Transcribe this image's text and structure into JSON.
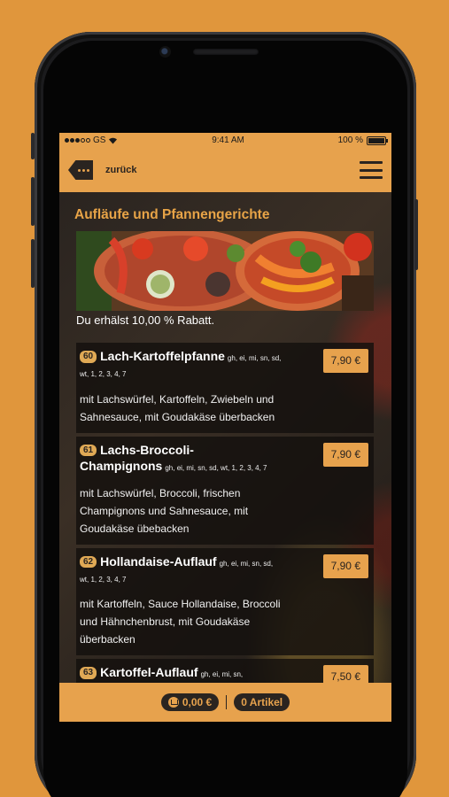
{
  "status": {
    "carrier": "GS",
    "time": "9:41 AM",
    "battery": "100 %"
  },
  "nav": {
    "back_label": "zurück"
  },
  "category": {
    "title": "Aufläufe und Pfannengerichte",
    "discount_text": "Du erhälst 10,00 % Rabatt."
  },
  "items": [
    {
      "number": "60",
      "name": "Lach-Kartoffelpfanne",
      "allergens": "gh, ei, mi, sn, sd, wt, 1, 2, 3, 4, 7",
      "price": "7,90 €",
      "description": "mit Lachswürfel, Kartoffeln, Zwiebeln und Sahnesauce, mit Goudakäse überbacken"
    },
    {
      "number": "61",
      "name": "Lachs-Broccoli-Champignons",
      "allergens": "gh, ei, mi, sn, sd, wt, 1, 2, 3, 4, 7",
      "price": "7,90 €",
      "description": "mit Lachswürfel, Broccoli, frischen Champignons und Sahnesauce, mit Goudakäse übebacken"
    },
    {
      "number": "62",
      "name": "Hollandaise-Auflauf",
      "allergens": "gh, ei, mi, sn, sd, wt, 1, 2, 3, 4, 7",
      "price": "7,90 €",
      "description": "mit Kartoffeln, Sauce Hollandaise, Broccoli und Hähnchenbrust, mit Goudakäse überbacken"
    },
    {
      "number": "63",
      "name": "Kartoffel-Auflauf",
      "allergens": "gh, ei, mi, sn,",
      "price": "7,50 €",
      "description": ""
    }
  ],
  "cart": {
    "total": "0,00 €",
    "count": "0 Artikel"
  },
  "colors": {
    "accent": "#E7A24D",
    "dark": "#2a2420",
    "background": "#E0963C"
  }
}
